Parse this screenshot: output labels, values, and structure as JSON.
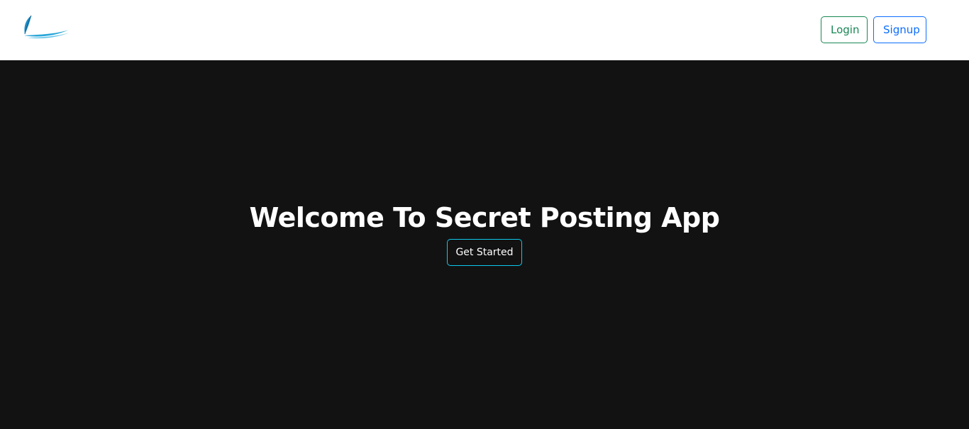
{
  "navbar": {
    "logo_icon": "quill-feather-icon",
    "login_label": "Login",
    "signup_label": "Signup"
  },
  "hero": {
    "title": "Welcome To Secret Posting App",
    "cta_label": "Get Started"
  },
  "colors": {
    "navbar_bg": "#ffffff",
    "hero_bg": "#121212",
    "login_accent": "#198754",
    "signup_accent": "#0d6efd",
    "cta_accent": "#0dcaf0",
    "logo_blue": "#1e8fc8"
  }
}
